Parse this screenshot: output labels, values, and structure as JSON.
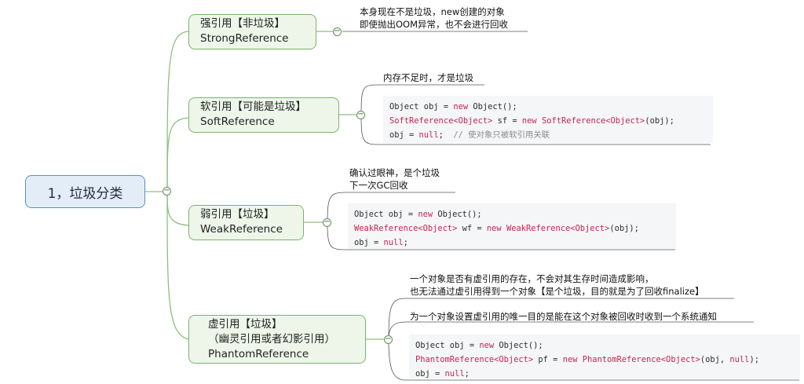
{
  "root": {
    "label": "1，垃圾分类"
  },
  "branches": [
    {
      "title": "强引用【非垃圾】",
      "subtitle": "StrongReference",
      "notes": [
        "本身现在不是垃圾，new创建的对象",
        "即使抛出OOM异常，也不会进行回收"
      ]
    },
    {
      "title": "软引用【可能是垃圾】",
      "subtitle": "SoftReference",
      "notes": [
        "内存不足时，才是垃圾"
      ],
      "code": [
        [
          {
            "t": "Object obj = "
          },
          {
            "t": "new",
            "k": 1
          },
          {
            "t": " Object();"
          }
        ],
        [
          {
            "t": "SoftReference<Object>",
            "k": 1
          },
          {
            "t": " sf = "
          },
          {
            "t": "new SoftReference<Object>",
            "k": 1
          },
          {
            "t": "(obj);"
          }
        ],
        [
          {
            "t": "obj = "
          },
          {
            "t": "null",
            "k": 1
          },
          {
            "t": ";  "
          },
          {
            "t": "// 使对象只被软引用关联",
            "c": 1
          }
        ]
      ]
    },
    {
      "title": "弱引用【垃圾】",
      "subtitle": "WeakReference",
      "notes": [
        "确认过眼神，是个垃圾",
        "下一次GC回收"
      ],
      "code": [
        [
          {
            "t": "Object obj = "
          },
          {
            "t": "new",
            "k": 1
          },
          {
            "t": " Object();"
          }
        ],
        [
          {
            "t": "WeakReference<Object>",
            "k": 1
          },
          {
            "t": " wf = "
          },
          {
            "t": "new WeakReference<Object>",
            "k": 1
          },
          {
            "t": "(obj);"
          }
        ],
        [
          {
            "t": "obj = "
          },
          {
            "t": "null",
            "k": 1
          },
          {
            "t": ";"
          }
        ]
      ]
    },
    {
      "title": "虚引用【垃圾】",
      "subtitle2": "（幽灵引用或者幻影引用）",
      "subtitle": "PhantomReference",
      "notes": [
        "一个对象是否有虚引用的存在，不会对其生存时间造成影响，",
        "也无法通过虚引用得到一个对象【是个垃圾，目的就是为了回收finalize】"
      ],
      "notes2": [
        "为一个对象设置虚引用的唯一目的是能在这个对象被回收时收到一个系统通知"
      ],
      "code": [
        [
          {
            "t": "Object obj = "
          },
          {
            "t": "new",
            "k": 1
          },
          {
            "t": " Object();"
          }
        ],
        [
          {
            "t": "PhantomReference<Object>",
            "k": 1
          },
          {
            "t": " pf = "
          },
          {
            "t": "new PhantomReference<Object>",
            "k": 1
          },
          {
            "t": "(obj, "
          },
          {
            "t": "null",
            "k": 1
          },
          {
            "t": ");"
          }
        ],
        [
          {
            "t": "obj = "
          },
          {
            "t": "null",
            "k": 1
          },
          {
            "t": ";"
          }
        ]
      ]
    }
  ],
  "colors": {
    "node_fill": "#eef6ea",
    "node_border": "#79b36b",
    "root_fill": "#e3edf8",
    "root_border": "#5b8ec7",
    "keyword": "#c7254e"
  }
}
